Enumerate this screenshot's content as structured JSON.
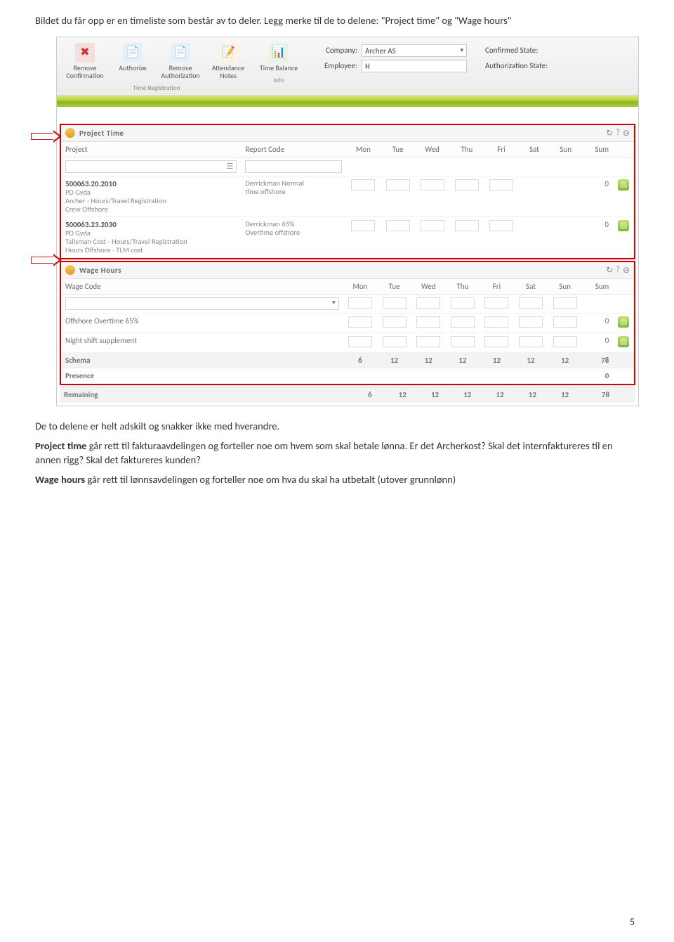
{
  "intro": {
    "line1": "Bildet du får opp er en timeliste som består av to deler. Legg merke til de to delene: \"Project time\" og \"Wage hours\""
  },
  "toolbar": {
    "remove_confirmation": "Remove Confirmation",
    "authorize": "Authorize",
    "remove_authorization": "Remove Authorization",
    "attendance_notes": "Attendance Notes",
    "time_balance": "Time Balance",
    "group_time_reg": "Time Registration",
    "group_info": "Info",
    "company_label": "Company:",
    "company_value": "Archer AS",
    "employee_label": "Employee:",
    "employee_value": "H",
    "confirmed_state": "Confirmed State:",
    "authorization_state": "Authorization State:"
  },
  "project_time": {
    "title": "Project Time",
    "col_project": "Project",
    "col_report": "Report Code",
    "days": [
      "Mon",
      "Tue",
      "Wed",
      "Thu",
      "Fri",
      "Sat",
      "Sun"
    ],
    "col_sum": "Sum",
    "rows": [
      {
        "code": "500063.20.2010",
        "l1": "PD Gyda",
        "l2": "Archer - Hours/Travel Registration",
        "l3": "Crew Offshore",
        "report1": "Derrickman Normal",
        "report2": "time offshore",
        "sum": "0"
      },
      {
        "code": "500063.23.2030",
        "l1": "PD Gyda",
        "l2": "Talisman Cost - Hours/Travel Registration",
        "l3": "Hours Offshore - TLM cost",
        "report1": "Derrickman 65%",
        "report2": "Overtime offshore",
        "sum": "0"
      }
    ]
  },
  "wage_hours": {
    "title": "Wage Hours",
    "col_wage": "Wage Code",
    "days": [
      "Mon",
      "Tue",
      "Wed",
      "Thu",
      "Fri",
      "Sat",
      "Sun"
    ],
    "col_sum": "Sum",
    "rows": [
      {
        "label": "Offshore Overtime 65%",
        "sum": "0"
      },
      {
        "label": "Night shift supplement",
        "sum": "0"
      }
    ],
    "summary": [
      {
        "label": "Schema",
        "vals": [
          "6",
          "12",
          "12",
          "12",
          "12",
          "12",
          "12"
        ],
        "sum": "78"
      },
      {
        "label": "Presence",
        "vals": [
          "",
          "",
          "",
          "",
          "",
          "",
          ""
        ],
        "sum": "0"
      },
      {
        "label": "Remaining",
        "vals": [
          "6",
          "12",
          "12",
          "12",
          "12",
          "12",
          "12"
        ],
        "sum": "78"
      }
    ]
  },
  "body": {
    "p1": "De to delene er helt adskilt og snakker ikke med hverandre.",
    "p2a": "Project time",
    "p2b": " går rett til fakturaavdelingen og forteller noe om hvem som skal betale lønna. Er det Archerkost? Skal det internfaktureres til en annen rigg? Skal det faktureres kunden?",
    "p3a": "Wage hours",
    "p3b": " går rett til lønnsavdelingen og forteller noe om hva du skal ha utbetalt (utover grunnlønn)"
  },
  "page_number": "5"
}
